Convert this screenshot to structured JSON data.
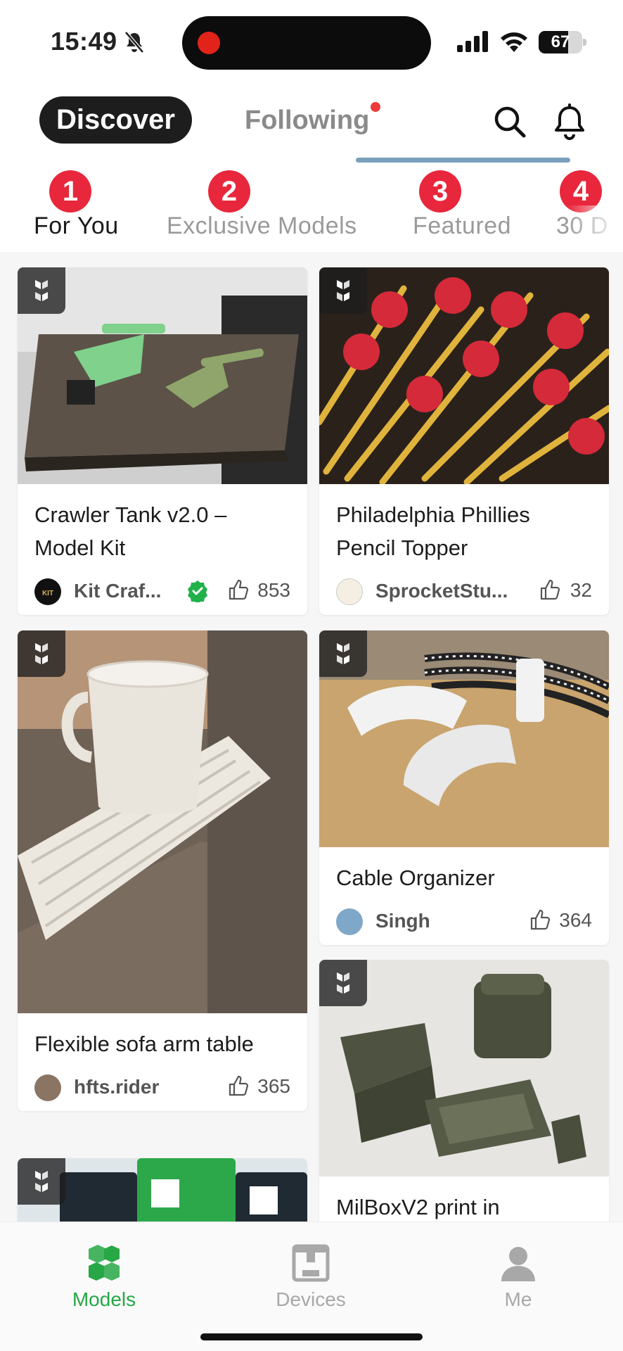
{
  "status_bar": {
    "time": "15:49",
    "battery": "67",
    "battery_level": 0.67
  },
  "header": {
    "tabs": [
      "Discover",
      "Following"
    ]
  },
  "categories": [
    {
      "badge": "1",
      "label": "For You"
    },
    {
      "badge": "2",
      "label": "Exclusive Models"
    },
    {
      "badge": "3",
      "label": "Featured"
    },
    {
      "badge": "4",
      "label": "30 D"
    }
  ],
  "cards": [
    {
      "title": "Crawler Tank v2.0 – Model Kit",
      "author": "Kit Craf...",
      "likes": "853",
      "verified": true
    },
    {
      "title": "Philadelphia Phillies Pencil Topper",
      "author": "SprocketStu...",
      "likes": "32"
    },
    {
      "title": "Flexible sofa arm table",
      "author": "hfts.rider",
      "likes": "365"
    },
    {
      "title": "Cable Organizer",
      "author": "Singh",
      "likes": "364"
    },
    {
      "title": "MilBoxV2 print in"
    },
    {
      "title": ""
    }
  ],
  "nav": [
    {
      "label": "Models",
      "icon": "models-icon"
    },
    {
      "label": "Devices",
      "icon": "printer-icon"
    },
    {
      "label": "Me",
      "icon": "user-icon"
    }
  ],
  "colors": {
    "accent": "#27a745",
    "badge": "#e8273c",
    "verified": "#22b04b"
  }
}
